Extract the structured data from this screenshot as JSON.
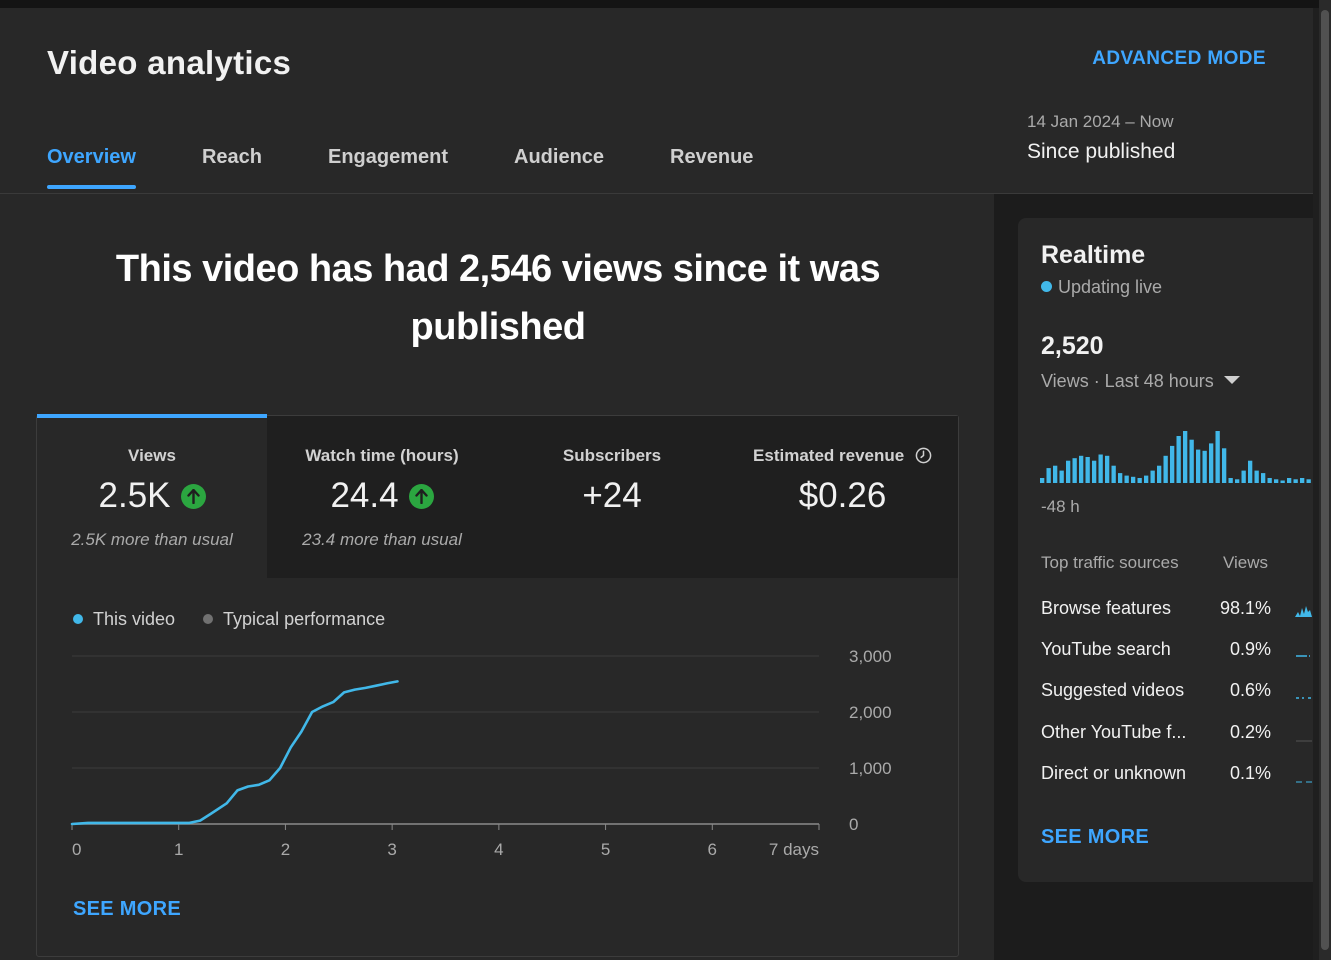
{
  "header": {
    "title": "Video analytics",
    "advanced_mode": "ADVANCED MODE",
    "tabs": [
      {
        "label": "Overview",
        "active": true
      },
      {
        "label": "Reach"
      },
      {
        "label": "Engagement"
      },
      {
        "label": "Audience"
      },
      {
        "label": "Revenue"
      }
    ],
    "date_range": "14 Jan 2024 – Now",
    "period": "Since published"
  },
  "main": {
    "headline": "This video has had 2,546 views since it was published",
    "metrics": [
      {
        "label": "Views",
        "value": "2.5K",
        "trend": "up",
        "subtext": "2.5K more than usual"
      },
      {
        "label": "Watch time (hours)",
        "value": "24.4",
        "trend": "up",
        "subtext": "23.4 more than usual"
      },
      {
        "label": "Subscribers",
        "value": "+24"
      },
      {
        "label": "Estimated revenue",
        "value": "$0.26",
        "icon": "clock-icon"
      }
    ],
    "legend": {
      "this_video": "This video",
      "typical": "Typical performance"
    },
    "see_more": "SEE MORE"
  },
  "chart_data": {
    "type": "line",
    "series": [
      {
        "name": "This video",
        "color": "#41b8e9",
        "points": [
          [
            0,
            0
          ],
          [
            0.15,
            20
          ],
          [
            0.5,
            20
          ],
          [
            0.9,
            20
          ],
          [
            1.1,
            20
          ],
          [
            1.2,
            60
          ],
          [
            1.3,
            180
          ],
          [
            1.45,
            370
          ],
          [
            1.55,
            600
          ],
          [
            1.65,
            670
          ],
          [
            1.75,
            700
          ],
          [
            1.85,
            780
          ],
          [
            1.95,
            1000
          ],
          [
            2.05,
            1370
          ],
          [
            2.15,
            1650
          ],
          [
            2.25,
            2000
          ],
          [
            2.35,
            2100
          ],
          [
            2.45,
            2180
          ],
          [
            2.55,
            2350
          ],
          [
            2.65,
            2400
          ],
          [
            2.75,
            2430
          ],
          [
            2.85,
            2470
          ],
          [
            2.95,
            2510
          ],
          [
            3.05,
            2546
          ]
        ]
      }
    ],
    "xlim": [
      0,
      7
    ],
    "ylim": [
      0,
      3000
    ],
    "x_ticks": [
      "0",
      "1",
      "2",
      "3",
      "4",
      "5",
      "6",
      "7 days"
    ],
    "y_ticks": [
      "3,000",
      "2,000",
      "1,000",
      "0"
    ],
    "y_tick_values": [
      3000,
      2000,
      1000,
      0
    ]
  },
  "realtime": {
    "title": "Realtime",
    "live_label": "Updating live",
    "count": "2,520",
    "period_label": "Views · Last 48 hours",
    "axis_label": "-48 h",
    "hourly_views": [
      4,
      12,
      14,
      10,
      18,
      20,
      22,
      21,
      18,
      23,
      22,
      14,
      8,
      6,
      5,
      4,
      6,
      10,
      14,
      22,
      30,
      38,
      42,
      35,
      27,
      26,
      32,
      42,
      28,
      4,
      3,
      10,
      18,
      10,
      8,
      4,
      3,
      2,
      4,
      3,
      4,
      3
    ],
    "traffic_sources_header": "Top traffic sources",
    "views_header": "Views",
    "traffic_sources": [
      {
        "name": "Browse features",
        "pct": "98.1%"
      },
      {
        "name": "YouTube search",
        "pct": "0.9%"
      },
      {
        "name": "Suggested videos",
        "pct": "0.6%"
      },
      {
        "name": "Other YouTube f...",
        "pct": "0.2%"
      },
      {
        "name": "Direct or unknown",
        "pct": "0.1%"
      }
    ],
    "see_more": "SEE MORE"
  }
}
